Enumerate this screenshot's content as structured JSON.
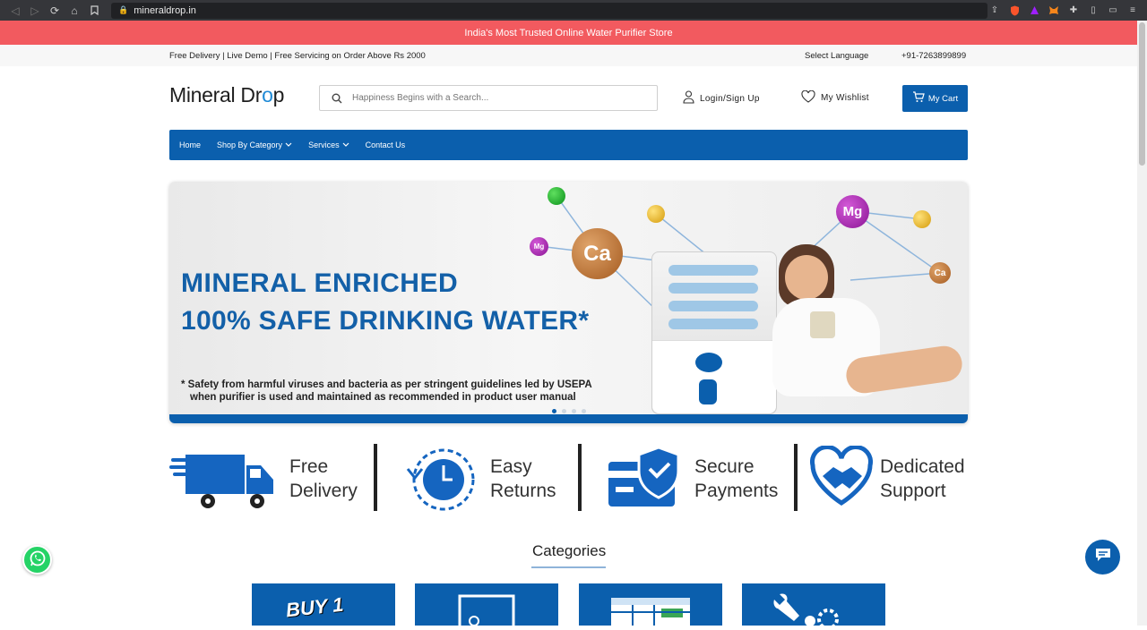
{
  "browser": {
    "url": "mineraldrop.in"
  },
  "promo_bar": {
    "text": "India's Most Trusted Online Water Purifier Store"
  },
  "info_bar": {
    "left_text": "Free Delivery | Live Demo | Free Servicing on Order Above Rs 2000",
    "language_label": "Select Language",
    "phone": "+91-7263899899"
  },
  "header": {
    "logo_text_part1": "Mineral Dr",
    "logo_text_drop": "o",
    "logo_text_part2": "p",
    "search_placeholder": "Happiness Begins with a Search...",
    "login_label": "Login/Sign Up",
    "wishlist_label": "My Wishlist",
    "cart_label": "My Cart"
  },
  "nav": {
    "items": [
      {
        "label": "Home"
      },
      {
        "label": "Shop By Category"
      },
      {
        "label": "Services"
      },
      {
        "label": "Contact Us"
      }
    ]
  },
  "hero": {
    "headline_line1": "MINERAL ENRICHED",
    "headline_line2": "100% SAFE DRINKING WATER*",
    "note_line1": "* Safety from harmful viruses and bacteria as per stringent guidelines led by USEPA",
    "note_line2": "when purifier is used and maintained as recommended in product user manual",
    "molecules": {
      "ca_large": "Ca",
      "mg_small": "Mg",
      "mg_large": "Mg",
      "ca_small": "Ca"
    },
    "slider_dots": 4,
    "active_dot": 1,
    "colors": {
      "brand_blue": "#0b5fad",
      "headline_blue": "#1360a8"
    }
  },
  "features": [
    {
      "line1": "Free",
      "line2": "Delivery",
      "icon": "delivery-truck-icon"
    },
    {
      "line1": "Easy",
      "line2": "Returns",
      "icon": "return-clock-icon"
    },
    {
      "line1": "Secure",
      "line2": "Payments",
      "icon": "secure-card-shield-icon"
    },
    {
      "line1": "Dedicated",
      "line2": "Support",
      "icon": "handshake-heart-icon"
    }
  ],
  "categories": {
    "title": "Categories",
    "card_partial_text": "BUY 1"
  }
}
